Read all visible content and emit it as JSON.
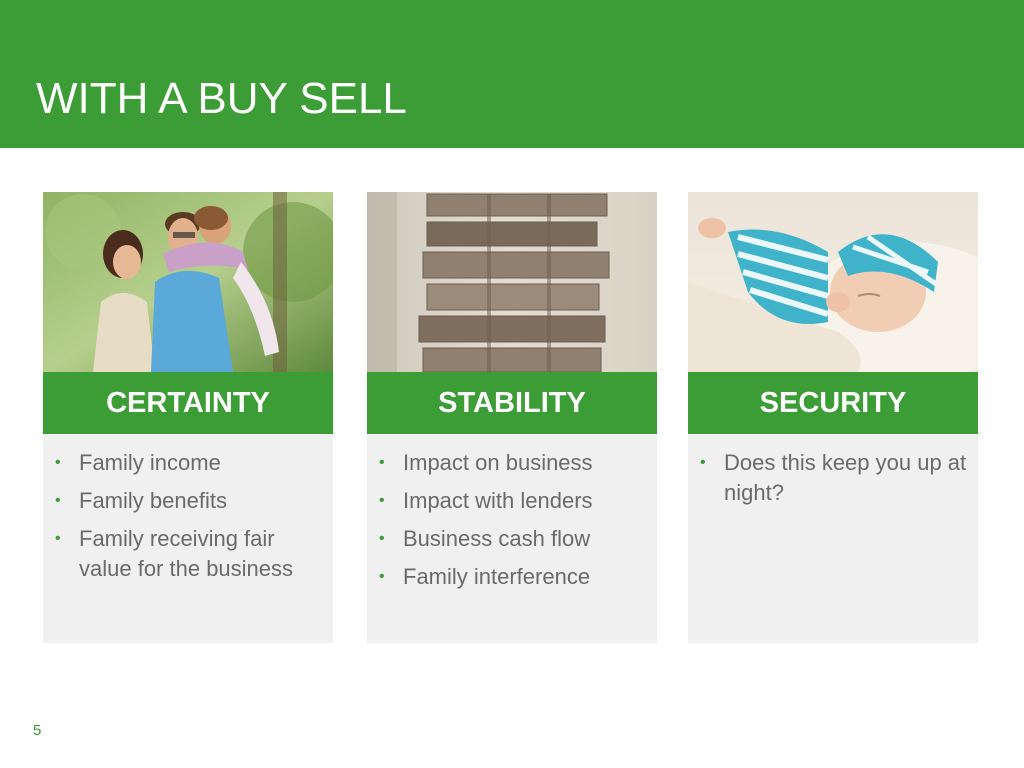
{
  "slide": {
    "title": "WITH A BUY SELL",
    "page_number": "5",
    "accent_color": "#3c9c36",
    "cards": [
      {
        "heading": "CERTAINTY",
        "image": "family-photo",
        "bullets": [
          "Family income",
          "Family benefits",
          "Family receiving fair value for the business"
        ]
      },
      {
        "heading": "STABILITY",
        "image": "wooden-block-tower-photo",
        "bullets": [
          "Impact on business",
          "Impact with lenders",
          "Business cash flow",
          "Family interference"
        ]
      },
      {
        "heading": "SECURITY",
        "image": "sleeping-baby-photo",
        "bullets": [
          "Does this keep you up at night?"
        ]
      }
    ]
  }
}
